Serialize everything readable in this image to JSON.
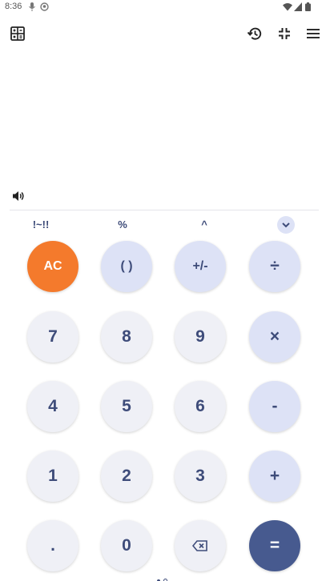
{
  "status_bar": {
    "time": "8:36"
  },
  "toolbar": {
    "mode_icon": "calculator-grid-icon",
    "history_icon": "history-icon",
    "collapse_icon": "collapse-icon",
    "menu_icon": "hamburger-menu-icon"
  },
  "display": {
    "expression": "",
    "result": ""
  },
  "scientific": {
    "items": [
      {
        "label": "!~!!"
      },
      {
        "label": "%"
      },
      {
        "label": "^"
      }
    ]
  },
  "keypad": {
    "row1": [
      {
        "label": "AC"
      },
      {
        "label": "( )"
      },
      {
        "label": "+/-"
      },
      {
        "label": "÷"
      }
    ],
    "row2": [
      {
        "label": "7"
      },
      {
        "label": "8"
      },
      {
        "label": "9"
      },
      {
        "label": "×"
      }
    ],
    "row3": [
      {
        "label": "4"
      },
      {
        "label": "5"
      },
      {
        "label": "6"
      },
      {
        "label": "-"
      }
    ],
    "row4": [
      {
        "label": "1"
      },
      {
        "label": "2"
      },
      {
        "label": "3"
      },
      {
        "label": "+"
      }
    ],
    "row5": [
      {
        "label": "."
      },
      {
        "label": "0"
      },
      {
        "label": ""
      },
      {
        "label": "="
      }
    ]
  },
  "colors": {
    "accent_orange": "#f47a2c",
    "equals_blue": "#475a8f",
    "operator_bg": "#dde2f6",
    "digit_bg": "#eff0f6",
    "key_text": "#3e4c7a"
  }
}
